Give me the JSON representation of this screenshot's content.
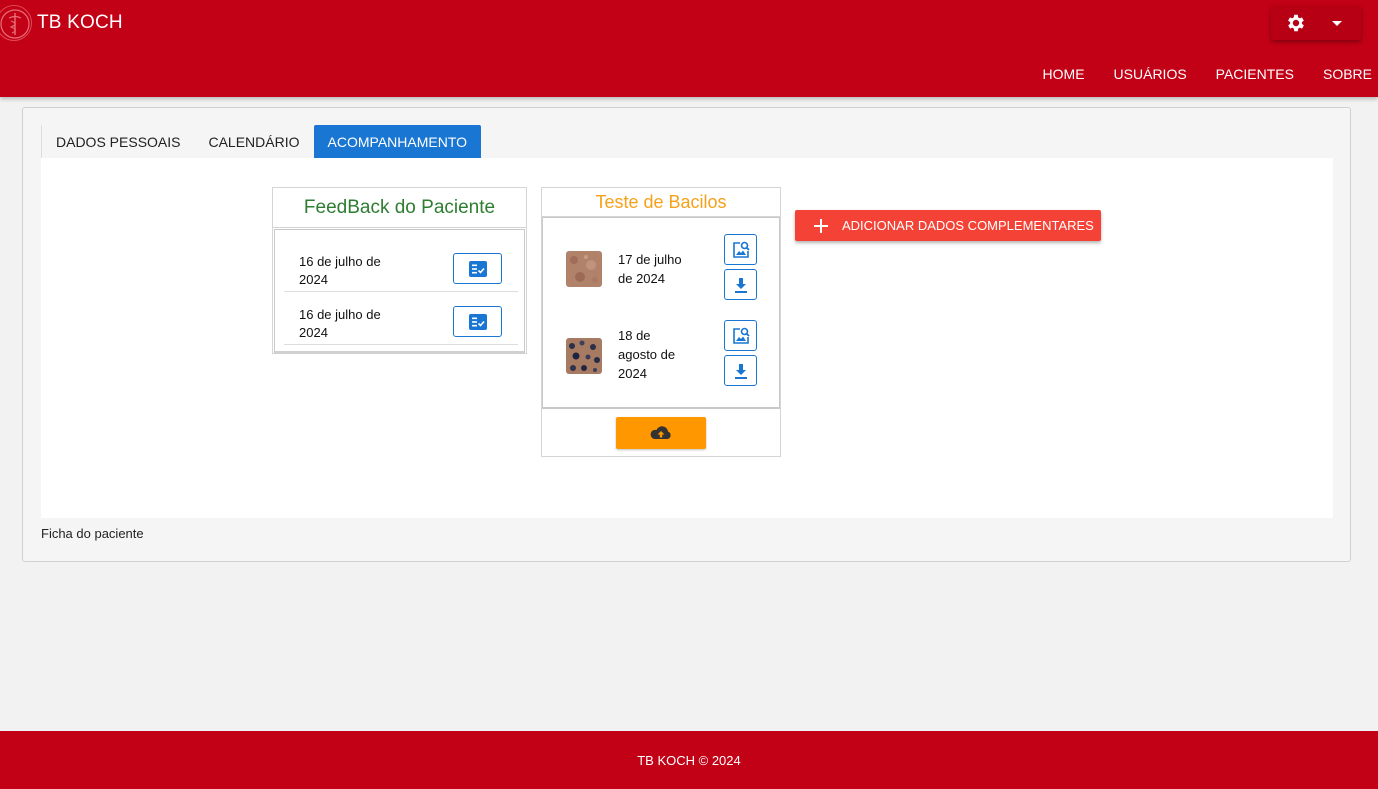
{
  "header": {
    "title": "TB KOCH",
    "logo_icon": "caduceus-logo-icon",
    "settings_icon": "gear-icon",
    "nav": [
      "HOME",
      "USUÁRIOS",
      "PACIENTES",
      "SOBRE"
    ]
  },
  "tabs": [
    {
      "label": "DADOS PESSOAIS",
      "active": false
    },
    {
      "label": "CALENDÁRIO",
      "active": false
    },
    {
      "label": "ACOMPANHAMENTO",
      "active": true
    }
  ],
  "feedback": {
    "title": "FeedBack do Paciente",
    "entries": [
      {
        "date": "16 de julho de 2024",
        "action_icon": "checklist-icon"
      },
      {
        "date": "16 de julho de 2024",
        "action_icon": "checklist-icon"
      }
    ]
  },
  "bacilos": {
    "title": "Teste de Bacilos",
    "entries": [
      {
        "date": "17 de julho de 2024",
        "view_icon": "image-search-icon",
        "download_icon": "download-icon"
      },
      {
        "date": "18 de agosto de 2024",
        "view_icon": "image-search-icon",
        "download_icon": "download-icon"
      }
    ],
    "upload_icon": "cloud-upload-icon"
  },
  "add_button": {
    "label": "ADICIONAR DADOS COMPLEMENTARES",
    "icon": "plus-icon"
  },
  "card_footer": "Ficha do paciente",
  "footer": {
    "text": "TB KOCH © 2024"
  },
  "colors": {
    "brand_red": "#c20016",
    "tab_active": "#1976d2",
    "feedback_title": "#2e7d32",
    "bacilos_title": "#f5a11a",
    "upload": "#ff9800",
    "add_button": "#f44336"
  }
}
